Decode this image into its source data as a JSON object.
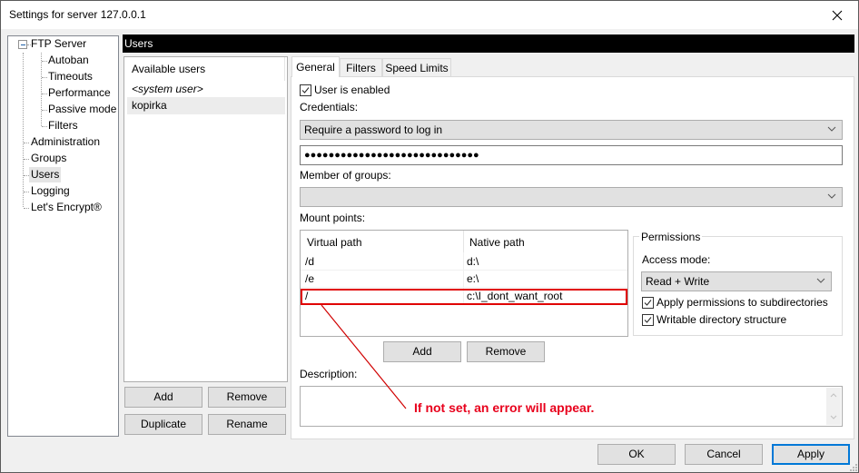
{
  "window": {
    "title": "Settings for server 127.0.0.1"
  },
  "tree": {
    "root": {
      "label": "FTP Server",
      "expanded": true,
      "children": [
        "Autoban",
        "Timeouts",
        "Performance",
        "Passive mode",
        "Filters"
      ]
    },
    "items": [
      "Administration",
      "Groups",
      "Users",
      "Logging",
      "Let's Encrypt®"
    ],
    "selected": "Users"
  },
  "header": {
    "title": "Users"
  },
  "users": {
    "column_header": "Available users",
    "items": [
      {
        "label": "<system user>",
        "italic": true
      },
      {
        "label": "kopirka",
        "selected": true
      }
    ],
    "buttons": {
      "add": "Add",
      "remove": "Remove",
      "duplicate": "Duplicate",
      "rename": "Rename"
    }
  },
  "tabs": [
    {
      "label": "General",
      "active": true
    },
    {
      "label": "Filters",
      "active": false
    },
    {
      "label": "Speed Limits",
      "active": false
    }
  ],
  "general": {
    "user_enabled": {
      "label": "User is enabled",
      "checked": true
    },
    "credentials_label": "Credentials:",
    "credentials_mode": "Require a password to log in",
    "password_value": "●●●●●●●●●●●●●●●●●●●●●●●●●●●●●",
    "groups_label": "Member of groups:",
    "groups_value": "",
    "mount_points_label": "Mount points:",
    "mount_table": {
      "columns": [
        "Virtual path",
        "Native path"
      ],
      "rows": [
        {
          "virtual": "/d",
          "native": "d:\\"
        },
        {
          "virtual": "/e",
          "native": "e:\\"
        },
        {
          "virtual": "/",
          "native": "c:\\I_dont_want_root",
          "highlighted": true
        }
      ]
    },
    "mount_buttons": {
      "add": "Add",
      "remove": "Remove"
    },
    "permissions": {
      "title": "Permissions",
      "access_mode_label": "Access mode:",
      "access_mode_value": "Read + Write",
      "apply_subdirs": {
        "label": "Apply permissions to subdirectories",
        "checked": true
      },
      "writable_structure": {
        "label": "Writable directory structure",
        "checked": true
      }
    },
    "description_label": "Description:",
    "description_value": ""
  },
  "annotation": {
    "text": "If not set, an error will appear.",
    "color": "#e8001c"
  },
  "footer": {
    "ok": "OK",
    "cancel": "Cancel",
    "apply": "Apply"
  },
  "colors": {
    "header_bg": "#000000",
    "accent": "#0078d7",
    "highlight_border": "#e00000"
  }
}
